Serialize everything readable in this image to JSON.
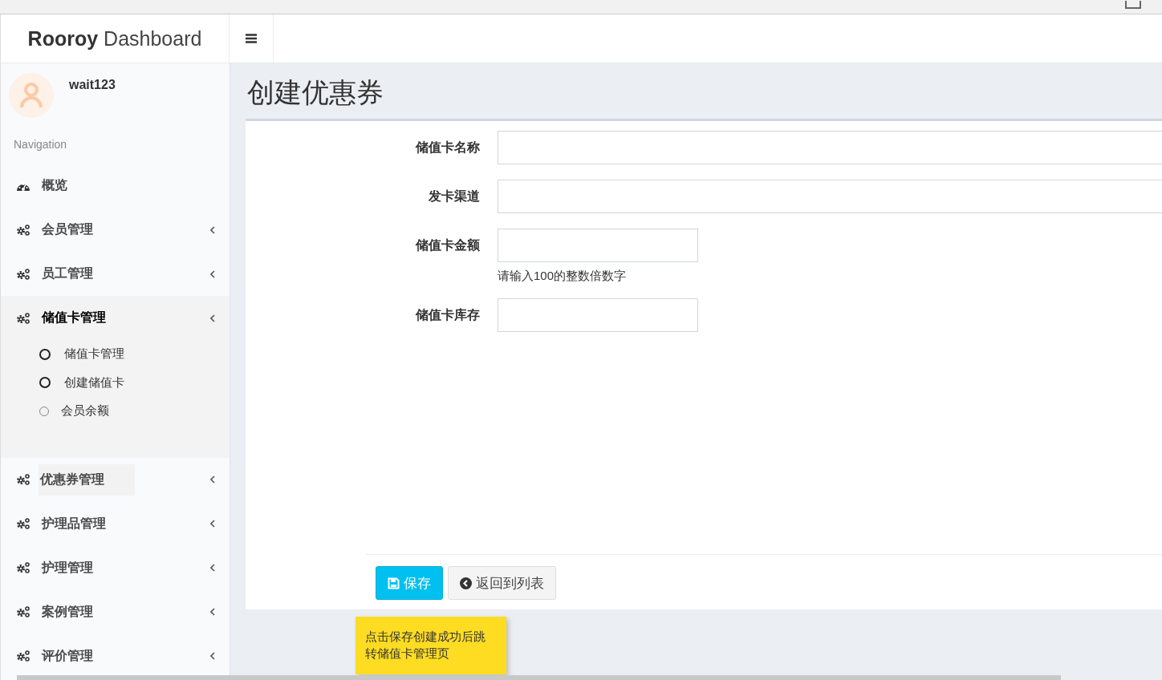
{
  "brand": {
    "bold": "Rooroy",
    "light": "Dashboard"
  },
  "user": {
    "name": "wait123"
  },
  "sidebar": {
    "heading": "Navigation",
    "items": [
      {
        "label": "概览",
        "kind": "link",
        "expanded": false,
        "hovered": false
      },
      {
        "label": "会员管理",
        "kind": "group",
        "expanded": false,
        "hovered": false
      },
      {
        "label": "员工管理",
        "kind": "group",
        "expanded": false,
        "hovered": false
      },
      {
        "label": "储值卡管理",
        "kind": "group",
        "expanded": true,
        "hovered": false,
        "children": [
          {
            "label": "储值卡管理",
            "dimmed": false
          },
          {
            "label": "创建储值卡",
            "dimmed": false
          },
          {
            "label": "会员余额",
            "dimmed": true
          }
        ]
      },
      {
        "label": "优惠券管理",
        "kind": "group",
        "expanded": false,
        "hovered": true
      },
      {
        "label": "护理品管理",
        "kind": "group",
        "expanded": false,
        "hovered": false
      },
      {
        "label": "护理管理",
        "kind": "group",
        "expanded": false,
        "hovered": false
      },
      {
        "label": "案例管理",
        "kind": "group",
        "expanded": false,
        "hovered": false
      },
      {
        "label": "评价管理",
        "kind": "group",
        "expanded": false,
        "hovered": false
      }
    ]
  },
  "page": {
    "title": "创建优惠券"
  },
  "form": {
    "fields": [
      {
        "label": "储值卡名称",
        "kind": "wide"
      },
      {
        "label": "发卡渠道",
        "kind": "wide"
      },
      {
        "label": "储值卡金额",
        "kind": "narrow",
        "help": "请输入100的整数倍数字"
      },
      {
        "label": "储值卡库存",
        "kind": "narrow"
      }
    ],
    "buttons": [
      {
        "label": "保存",
        "kind": "primary"
      },
      {
        "label": "返回到列表",
        "kind": "default"
      }
    ]
  },
  "note": {
    "text": "点击保存创建成功后跳转储值卡管理页"
  }
}
